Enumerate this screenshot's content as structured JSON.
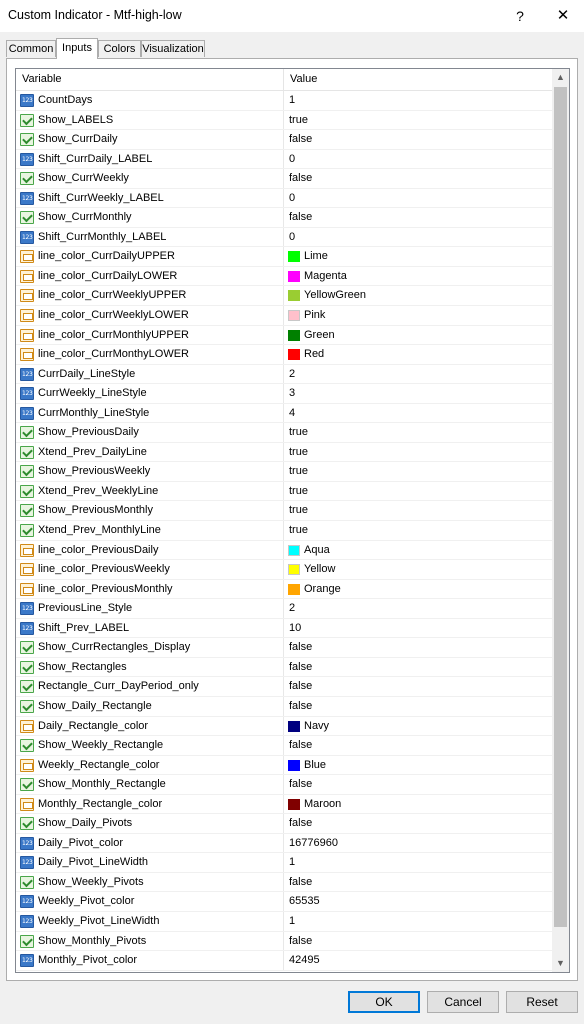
{
  "window": {
    "title": "Custom Indicator - Mtf-high-low",
    "help": "?",
    "close": "✕"
  },
  "tabs": [
    "Common",
    "Inputs",
    "Colors",
    "Visualization"
  ],
  "active_tab": "Inputs",
  "grid": {
    "columns": [
      "Variable",
      "Value"
    ],
    "rows": [
      {
        "name": "CountDays",
        "type": "num",
        "value": "1"
      },
      {
        "name": "Show_LABELS",
        "type": "bool",
        "value": "true"
      },
      {
        "name": "Show_CurrDaily",
        "type": "bool",
        "value": "false"
      },
      {
        "name": "Shift_CurrDaily_LABEL",
        "type": "num",
        "value": "0"
      },
      {
        "name": "Show_CurrWeekly",
        "type": "bool",
        "value": "false"
      },
      {
        "name": "Shift_CurrWeekly_LABEL",
        "type": "num",
        "value": "0"
      },
      {
        "name": "Show_CurrMonthly",
        "type": "bool",
        "value": "false"
      },
      {
        "name": "Shift_CurrMonthly_LABEL",
        "type": "num",
        "value": "0"
      },
      {
        "name": "line_color_CurrDailyUPPER",
        "type": "color",
        "value": "Lime",
        "swatch": "#00ff00"
      },
      {
        "name": "line_color_CurrDailyLOWER",
        "type": "color",
        "value": "Magenta",
        "swatch": "#ff00ff"
      },
      {
        "name": "line_color_CurrWeeklyUPPER",
        "type": "color",
        "value": "YellowGreen",
        "swatch": "#9acd32"
      },
      {
        "name": "line_color_CurrWeeklyLOWER",
        "type": "color",
        "value": "Pink",
        "swatch": "#ffc0cb"
      },
      {
        "name": "line_color_CurrMonthlyUPPER",
        "type": "color",
        "value": "Green",
        "swatch": "#008000"
      },
      {
        "name": "line_color_CurrMonthyLOWER",
        "type": "color",
        "value": "Red",
        "swatch": "#ff0000"
      },
      {
        "name": "CurrDaily_LineStyle",
        "type": "num",
        "value": "2"
      },
      {
        "name": "CurrWeekly_LineStyle",
        "type": "num",
        "value": "3"
      },
      {
        "name": "CurrMonthly_LineStyle",
        "type": "num",
        "value": "4"
      },
      {
        "name": "Show_PreviousDaily",
        "type": "bool",
        "value": "true"
      },
      {
        "name": "Xtend_Prev_DailyLine",
        "type": "bool",
        "value": "true"
      },
      {
        "name": "Show_PreviousWeekly",
        "type": "bool",
        "value": "true"
      },
      {
        "name": "Xtend_Prev_WeeklyLine",
        "type": "bool",
        "value": "true"
      },
      {
        "name": "Show_PreviousMonthly",
        "type": "bool",
        "value": "true"
      },
      {
        "name": "Xtend_Prev_MonthlyLine",
        "type": "bool",
        "value": "true"
      },
      {
        "name": "line_color_PreviousDaily",
        "type": "color",
        "value": "Aqua",
        "swatch": "#00ffff"
      },
      {
        "name": "line_color_PreviousWeekly",
        "type": "color",
        "value": "Yellow",
        "swatch": "#ffff00"
      },
      {
        "name": "line_color_PreviousMonthly",
        "type": "color",
        "value": "Orange",
        "swatch": "#ffa500"
      },
      {
        "name": "PreviousLine_Style",
        "type": "num",
        "value": "2"
      },
      {
        "name": "Shift_Prev_LABEL",
        "type": "num",
        "value": "10"
      },
      {
        "name": "Show_CurrRectangles_Display",
        "type": "bool",
        "value": "false"
      },
      {
        "name": "Show_Rectangles",
        "type": "bool",
        "value": "false"
      },
      {
        "name": "Rectangle_Curr_DayPeriod_only",
        "type": "bool",
        "value": "false"
      },
      {
        "name": "Show_Daily_Rectangle",
        "type": "bool",
        "value": "false"
      },
      {
        "name": "Daily_Rectangle_color",
        "type": "color",
        "value": "Navy",
        "swatch": "#000080"
      },
      {
        "name": "Show_Weekly_Rectangle",
        "type": "bool",
        "value": "false"
      },
      {
        "name": "Weekly_Rectangle_color",
        "type": "color",
        "value": "Blue",
        "swatch": "#0000ff"
      },
      {
        "name": "Show_Monthly_Rectangle",
        "type": "bool",
        "value": "false"
      },
      {
        "name": "Monthly_Rectangle_color",
        "type": "color",
        "value": "Maroon",
        "swatch": "#800000"
      },
      {
        "name": "Show_Daily_Pivots",
        "type": "bool",
        "value": "false"
      },
      {
        "name": "Daily_Pivot_color",
        "type": "num",
        "value": "16776960"
      },
      {
        "name": "Daily_Pivot_LineWidth",
        "type": "num",
        "value": "1"
      },
      {
        "name": "Show_Weekly_Pivots",
        "type": "bool",
        "value": "false"
      },
      {
        "name": "Weekly_Pivot_color",
        "type": "num",
        "value": "65535"
      },
      {
        "name": "Weekly_Pivot_LineWidth",
        "type": "num",
        "value": "1"
      },
      {
        "name": "Show_Monthly_Pivots",
        "type": "bool",
        "value": "false"
      },
      {
        "name": "Monthly_Pivot_color",
        "type": "num",
        "value": "42495"
      }
    ]
  },
  "buttons": {
    "ok": "OK",
    "cancel": "Cancel",
    "reset": "Reset"
  }
}
